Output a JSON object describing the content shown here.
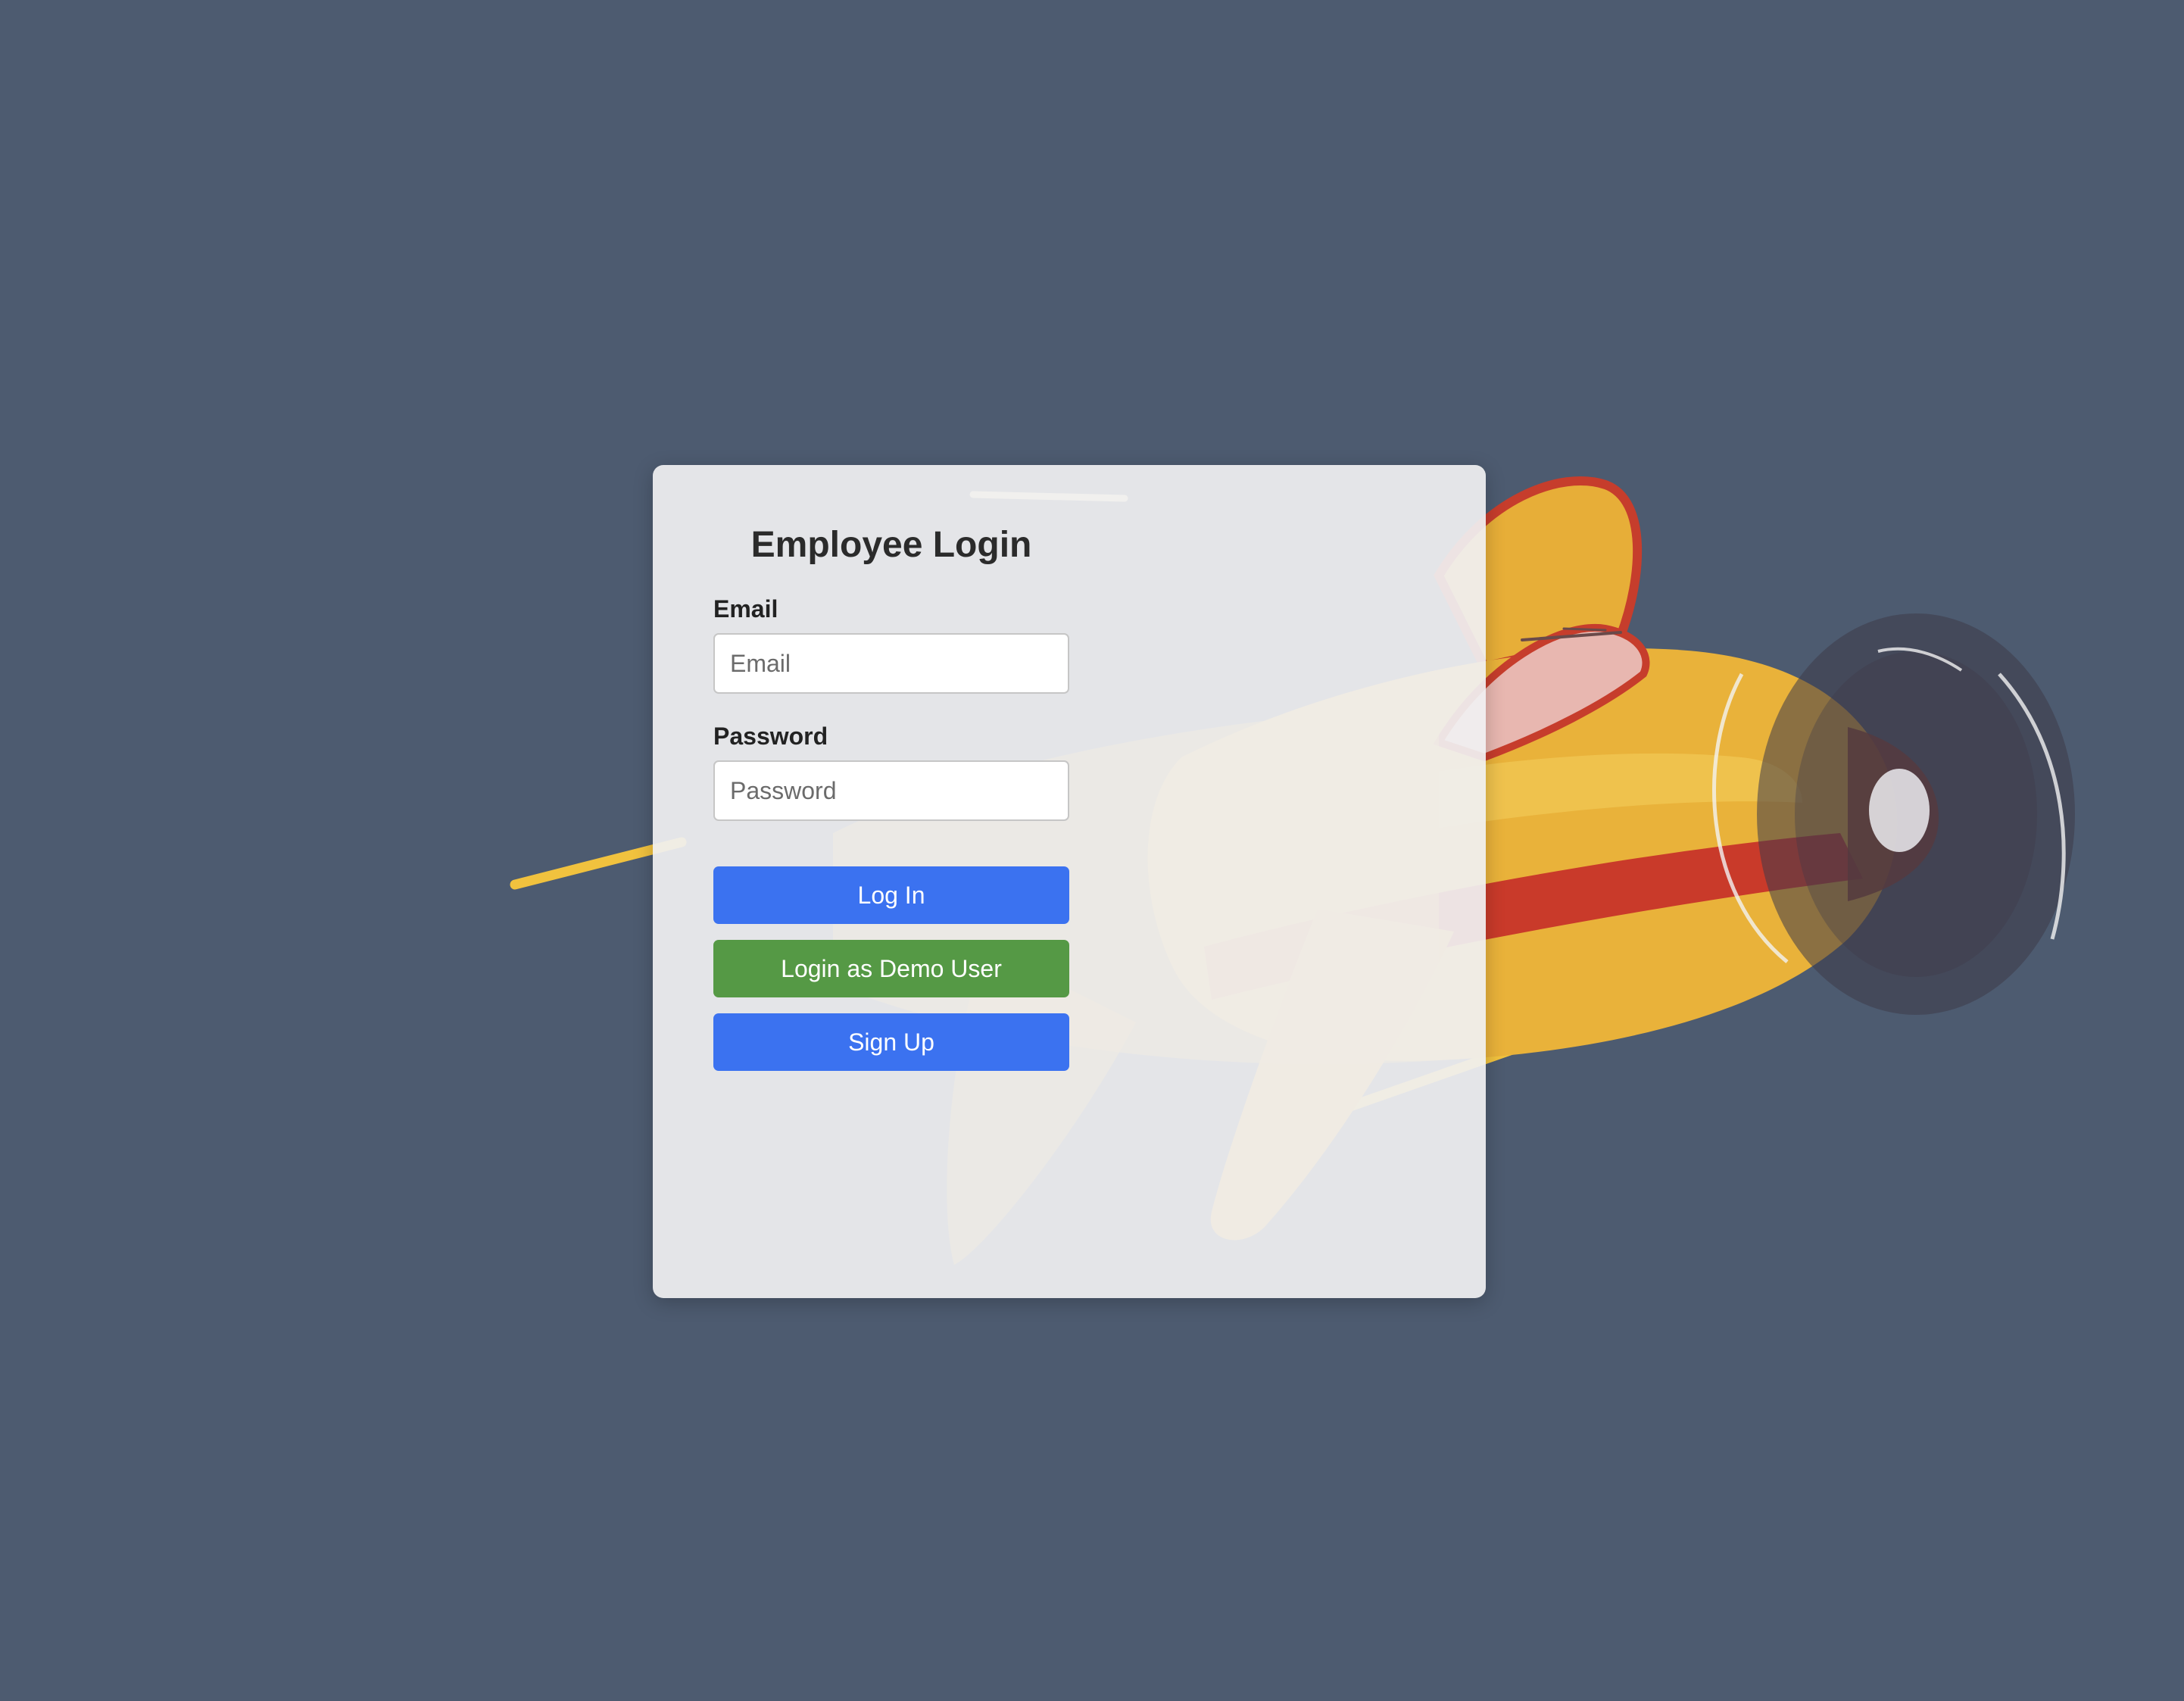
{
  "page": {
    "background_color": "#4d5b70"
  },
  "illustration": {
    "icon": "airplane-illustration",
    "colors": {
      "body": "#e9b23a",
      "stripe": "#c93a2a",
      "cockpit": "#e8b7b0",
      "propeller": "#3e3a48"
    }
  },
  "login": {
    "title": "Employee Login",
    "email": {
      "label": "Email",
      "placeholder": "Email",
      "value": ""
    },
    "password": {
      "label": "Password",
      "placeholder": "Password",
      "value": ""
    },
    "buttons": {
      "login": "Log In",
      "demo": "Login as Demo User",
      "signup": "Sign Up"
    },
    "colors": {
      "primary": "#3b72f0",
      "demo": "#559945"
    }
  }
}
